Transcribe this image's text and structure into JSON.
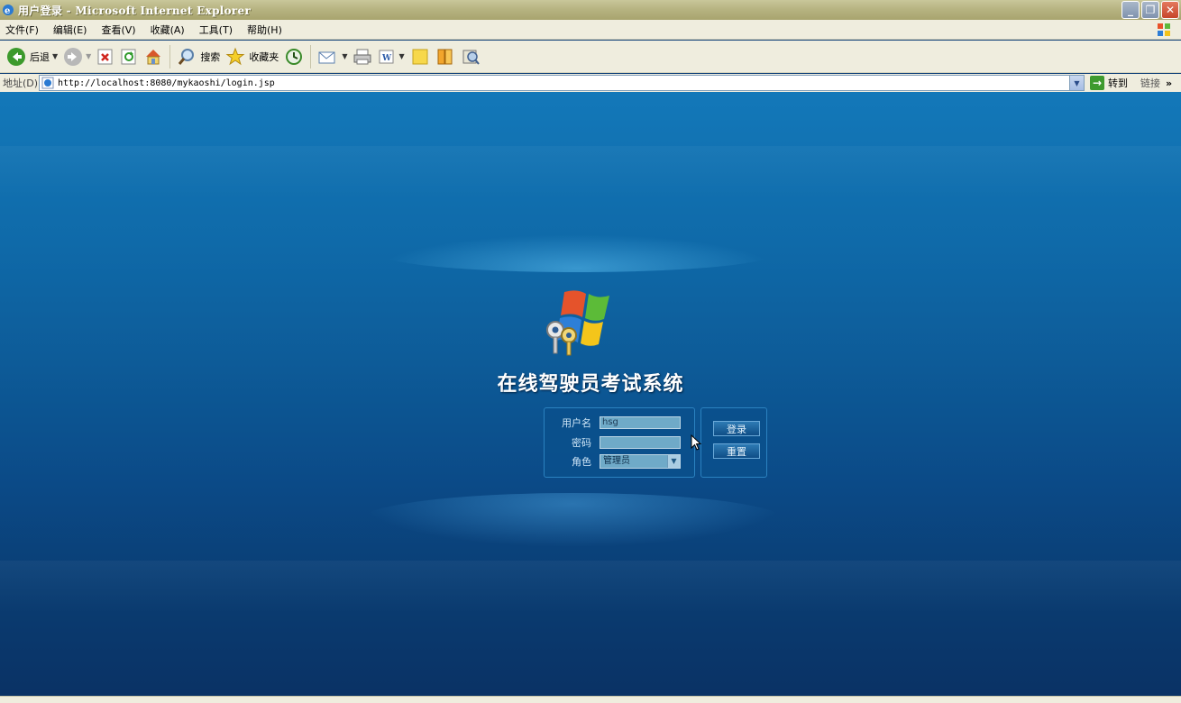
{
  "window": {
    "title": "用户登录 - Microsoft Internet Explorer",
    "controls": [
      "_",
      "❐",
      "✕"
    ]
  },
  "menu": {
    "items": [
      "文件(F)",
      "编辑(E)",
      "查看(V)",
      "收藏(A)",
      "工具(T)",
      "帮助(H)"
    ]
  },
  "toolbar": {
    "back_label": "后退",
    "search_label": "搜索",
    "favorites_label": "收藏夹"
  },
  "address": {
    "label": "地址(D)",
    "url": "http://localhost:8080/mykaoshi/login.jsp",
    "go_label": "转到",
    "links_label": "链接",
    "chevron": "»"
  },
  "page": {
    "system_title": "在线驾驶员考试系统",
    "username_label": "用户名",
    "username_value": "hsg",
    "password_label": "密码",
    "password_value": "",
    "role_label": "角色",
    "role_selected": "管理员",
    "login_button": "登录",
    "reset_button": "重置"
  },
  "colors": {
    "page_bg_top": "#1378b9",
    "page_bg_bottom": "#0a3265",
    "panel_bg": "#0a508c",
    "input_bg": "#6faac8"
  }
}
